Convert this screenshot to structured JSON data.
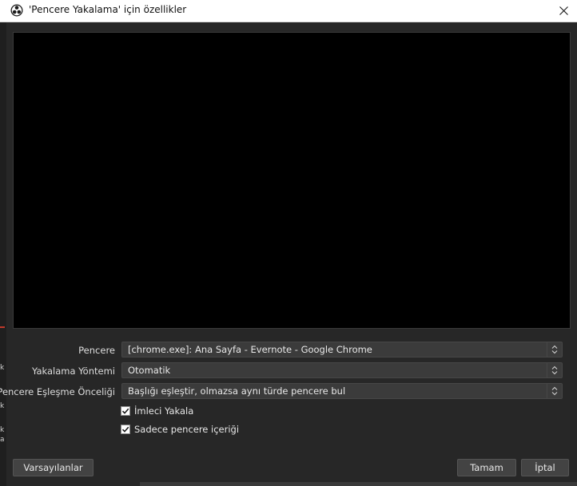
{
  "window": {
    "title": "'Pencere Yakalama' için özellikler",
    "app_icon": "obs-icon",
    "close_icon": "close-icon"
  },
  "background_window": {
    "left_glyphs": [
      "k",
      "k",
      "k",
      "a"
    ]
  },
  "form": {
    "rows": [
      {
        "label": "Pencere",
        "value": "[chrome.exe]: Ana Sayfa - Evernote - Google Chrome"
      },
      {
        "label": "Yakalama Yöntemi",
        "value": "Otomatik"
      },
      {
        "label": "Pencere Eşleşme Önceliği",
        "value": "Başlığı eşleştir, olmazsa aynı türde pencere bul"
      }
    ],
    "checkboxes": [
      {
        "label": "İmleci Yakala",
        "checked": true
      },
      {
        "label": "Sadece pencere içeriği",
        "checked": true
      }
    ]
  },
  "buttons": {
    "defaults": "Varsayılanlar",
    "ok": "Tamam",
    "cancel": "İptal"
  },
  "colors": {
    "background": "#2b2b2b",
    "preview": "#000000",
    "input": "#3b3b3b",
    "button": "#434343",
    "titlebar": "#ffffff"
  }
}
